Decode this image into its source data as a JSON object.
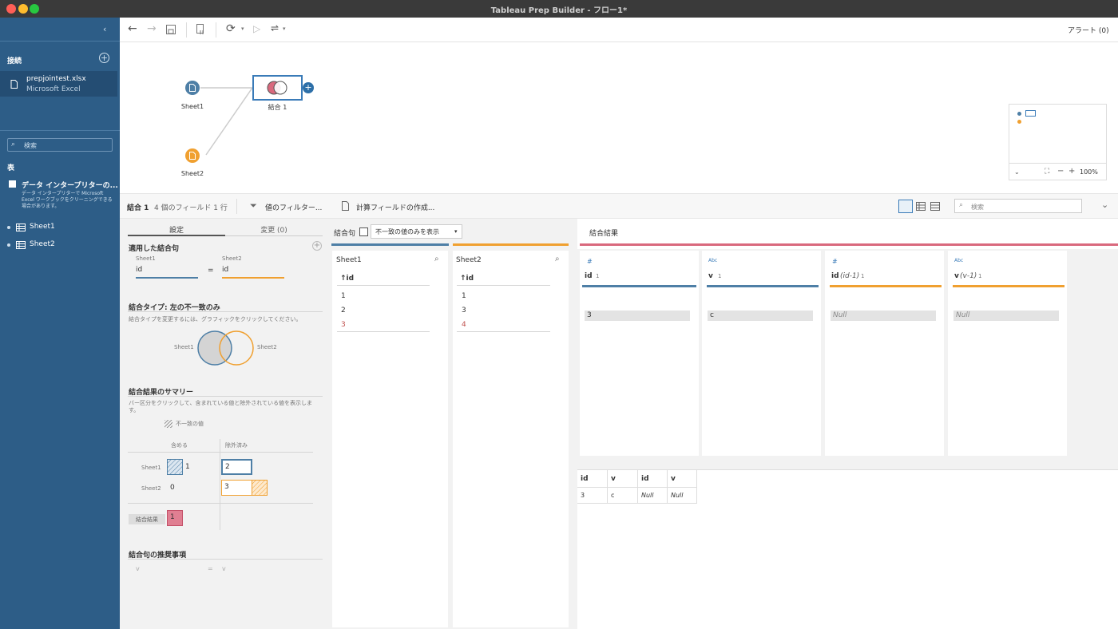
{
  "window": {
    "title": "Tableau Prep Builder - フロー1*"
  },
  "toolbar": {
    "alerts": "アラート (0)"
  },
  "sidebar": {
    "connections_title": "接続",
    "connection": {
      "name": "prepjointest.xlsx",
      "type": "Microsoft Excel"
    },
    "search_placeholder": "検索",
    "tables_title": "表",
    "interpreter": {
      "title": "データ インタープリターの...",
      "desc": "データ インタープリターで Microsoft Excel ワークブックをクリーニングできる場合があります。"
    },
    "tables": [
      "Sheet1",
      "Sheet2"
    ]
  },
  "canvas": {
    "nodes": {
      "sheet1": "Sheet1",
      "sheet2": "Sheet2",
      "join": "結合 1"
    },
    "zoom": "100%"
  },
  "stepbar": {
    "step_name": "結合 1",
    "summary": "4 個のフィールド 1 行",
    "filter_label": "値のフィルター...",
    "calc_label": "計算フィールドの作成...",
    "search_placeholder": "検索"
  },
  "config": {
    "tabs": {
      "settings": "設定",
      "changes": "変更 (0)"
    },
    "applied_clause_title": "適用した結合句",
    "left_source": "Sheet1",
    "right_source": "Sheet2",
    "left_field": "id",
    "right_field": "id",
    "equals": "=",
    "join_type_title": "結合タイプ: 左の不一致のみ",
    "join_type_desc": "結合タイプを変更するには、グラフィックをクリックしてください。",
    "venn_left": "Sheet1",
    "venn_right": "Sheet2",
    "summary_title": "結合結果のサマリー",
    "summary_desc": "バー区分をクリックして、含まれている値と除外されている値を表示します。",
    "mismatch_legend": "不一致の値",
    "col_included": "含める",
    "col_excluded": "除外済み",
    "rows": [
      {
        "name": "Sheet1",
        "included": "1",
        "excluded": "2"
      },
      {
        "name": "Sheet2",
        "included": "0",
        "excluded": "3"
      }
    ],
    "result_label": "結合結果",
    "result_value": "1",
    "recommend_title": "結合句の推奨事項",
    "rec_left": "v",
    "rec_eq": "=",
    "rec_right": "v"
  },
  "clause_pane": {
    "title": "結合句",
    "dropdown": "不一致の値のみを表示",
    "sheet1": {
      "name": "Sheet1",
      "field": "↑id",
      "values": [
        "1",
        "2",
        "3"
      ]
    },
    "sheet2": {
      "name": "Sheet2",
      "field": "↑id",
      "values": [
        "1",
        "3",
        "4"
      ]
    }
  },
  "result_pane": {
    "title": "結合結果",
    "fields": [
      {
        "type": "#",
        "name": "id",
        "suffix": "",
        "count": "1",
        "value": "3",
        "null": false
      },
      {
        "type": "Abc",
        "name": "v",
        "suffix": "",
        "count": "1",
        "value": "c",
        "null": false
      },
      {
        "type": "#",
        "name": "id",
        "suffix": "(id-1)",
        "count": "1",
        "value": "Null",
        "null": true
      },
      {
        "type": "Abc",
        "name": "v",
        "suffix": "(v-1)",
        "count": "1",
        "value": "Null",
        "null": true
      }
    ],
    "grid_headers": [
      "id",
      "v",
      "id",
      "v"
    ],
    "grid_row": [
      "3",
      "c",
      "Null",
      "Null"
    ]
  },
  "colors": {
    "sidebar": "#2d5d87",
    "blue": "#4e7fa6",
    "orange": "#f0a030",
    "pink": "#d9697d"
  }
}
